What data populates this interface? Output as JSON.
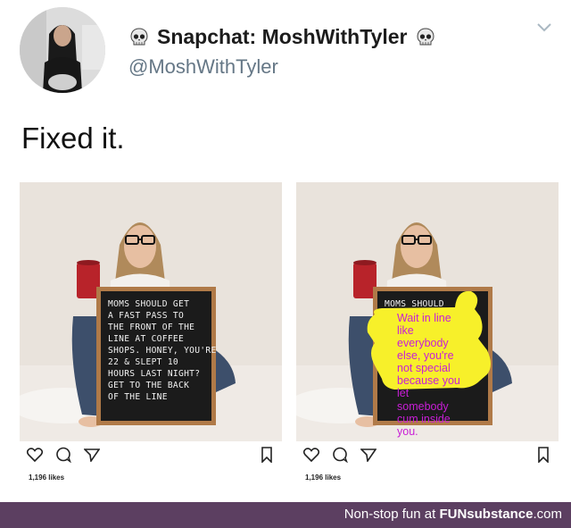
{
  "tweet": {
    "display_name": "Snapchat: MoshWithTyler",
    "handle": "@MoshWithTyler",
    "text": "Fixed it."
  },
  "icons": {
    "name_emoji": "skull-icon",
    "menu": "chevron-down-icon"
  },
  "left_post": {
    "sign_lines": [
      "MOMS SHOULD GET",
      "A FAST PASS TO",
      "THE FRONT OF THE",
      "LINE AT COFFEE",
      "SHOPS. HONEY, YOU'RE",
      "22 & SLEPT 10",
      "HOURS LAST NIGHT?",
      "GET TO THE BACK",
      "OF THE LINE"
    ],
    "likes": "1,196 likes"
  },
  "right_post": {
    "sign_header": "MOMS SHOULD",
    "overlay_lines_yellow": [
      "Wait in line",
      "like",
      "everybody",
      "else, you're",
      "not special",
      "because you",
      "let"
    ],
    "overlay_lines_dark": [
      "somebody",
      "cum inside",
      "you."
    ],
    "likes": "1,196 likes"
  },
  "footer": {
    "prefix": "Non-stop fun at ",
    "brand": "FUNsubstance",
    "suffix": ".com"
  },
  "colors": {
    "footer_bg": "#5c3f61",
    "handle": "#657786",
    "highlight": "#f7f02a",
    "overlay_text": "#c81ed6"
  }
}
